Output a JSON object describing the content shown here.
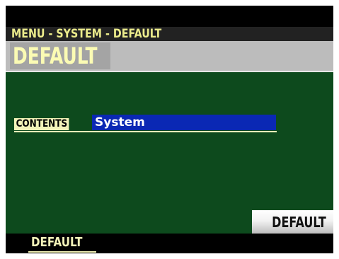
{
  "header": {
    "breadcrumb": "MENU - SYSTEM - DEFAULT",
    "title": "DEFAULT"
  },
  "main": {
    "parameter": {
      "label": "CONTENTS",
      "value": "System"
    },
    "action_button_label": "DEFAULT"
  },
  "footer": {
    "tabs": [
      {
        "label": "DEFAULT"
      }
    ]
  },
  "colors": {
    "panel": "#0d4a1d",
    "title_bar": "#bcbcbc",
    "title_text": "#fbfbb4",
    "breadcrumb_text": "#ecec8c",
    "label_background": "#f3f3b9",
    "value_highlight": "#0a28b4",
    "screen_background": "#000000"
  }
}
